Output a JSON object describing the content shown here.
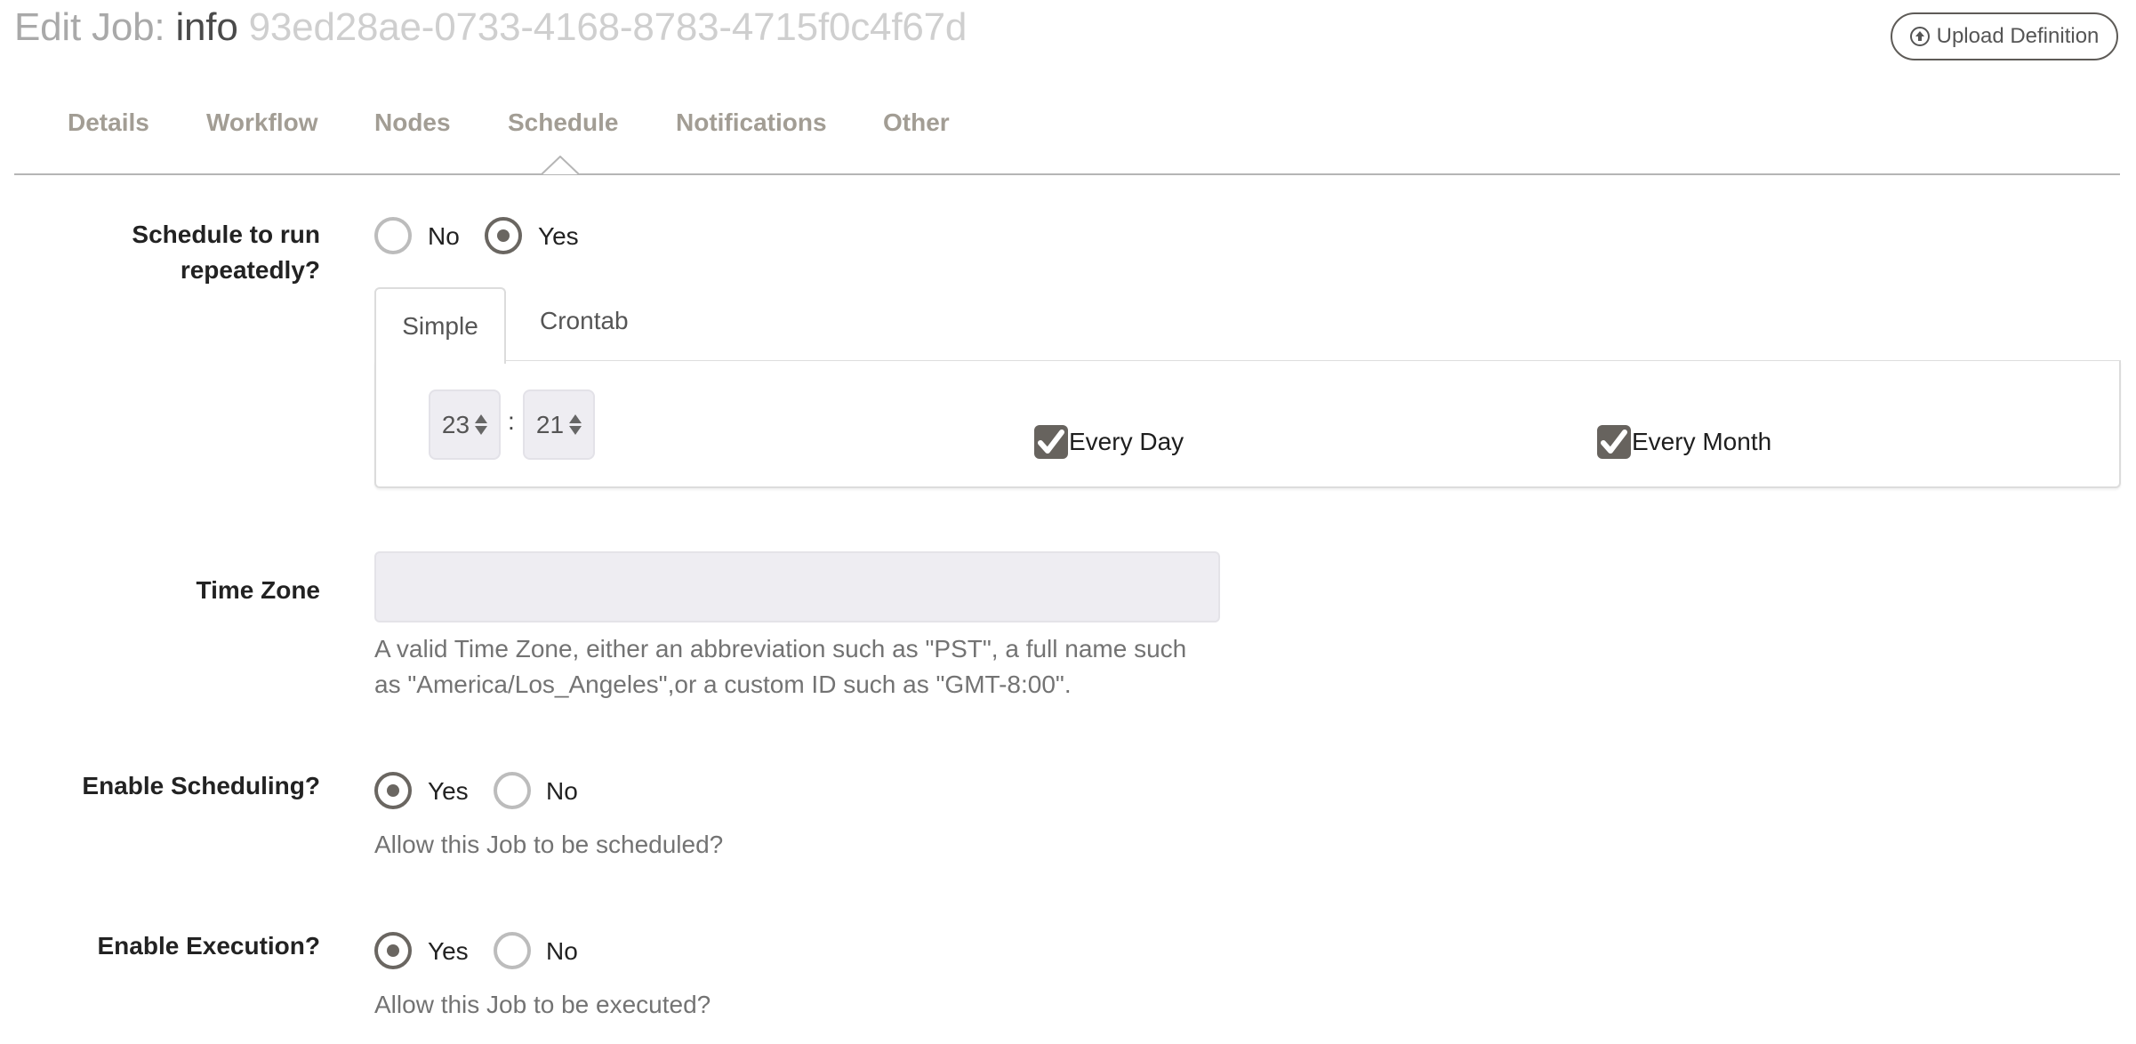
{
  "header": {
    "title_prefix": "Edit Job:",
    "job_name": "info",
    "job_id": "93ed28ae-0733-4168-8783-4715f0c4f67d",
    "upload_button": "Upload Definition",
    "upload_icon": "upload-circle-icon"
  },
  "tabs": [
    {
      "label": "Details",
      "active": false
    },
    {
      "label": "Workflow",
      "active": false
    },
    {
      "label": "Nodes",
      "active": false
    },
    {
      "label": "Schedule",
      "active": true
    },
    {
      "label": "Notifications",
      "active": false
    },
    {
      "label": "Other",
      "active": false
    }
  ],
  "schedule": {
    "label_line1": "Schedule to run",
    "label_line2": "repeatedly?",
    "options": [
      {
        "label": "No",
        "checked": false
      },
      {
        "label": "Yes",
        "checked": true
      }
    ],
    "subtabs": [
      {
        "label": "Simple",
        "active": true
      },
      {
        "label": "Crontab",
        "active": false
      }
    ],
    "hour": "23",
    "separator": ":",
    "minute": "21",
    "every_day": {
      "label": "Every Day",
      "checked": true
    },
    "every_month": {
      "label": "Every Month",
      "checked": true
    }
  },
  "time_zone": {
    "label": "Time Zone",
    "value": "",
    "placeholder": "",
    "help_line1": "A valid Time Zone, either an abbreviation such as \"PST\", a full name such",
    "help_line2": "as \"America/Los_Angeles\",or a custom ID such as \"GMT-8:00\"."
  },
  "enable_scheduling": {
    "label": "Enable Scheduling?",
    "options": [
      {
        "label": "Yes",
        "checked": true
      },
      {
        "label": "No",
        "checked": false
      }
    ],
    "help": "Allow this Job to be scheduled?"
  },
  "enable_execution": {
    "label": "Enable Execution?",
    "options": [
      {
        "label": "Yes",
        "checked": true
      },
      {
        "label": "No",
        "checked": false
      }
    ],
    "help": "Allow this Job to be executed?"
  },
  "colors": {
    "tab_text": "#a29d94",
    "radio_checked": "#6a6661",
    "checkbox_fill": "#67635e",
    "input_bg": "#eeedf2"
  }
}
